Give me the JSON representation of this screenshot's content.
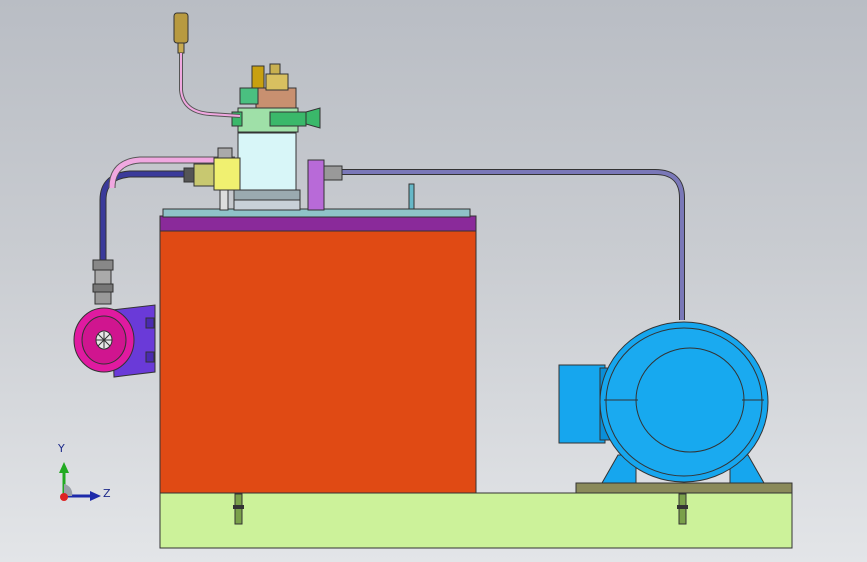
{
  "viewport": {
    "background_top": "#b9bdc4",
    "background_bottom": "#e3e5e8"
  },
  "model": {
    "tank_color": "#e04a14",
    "tank_lid_color": "#8a2a9a",
    "tank_top_plate_color": "#8fc3c8",
    "base_color": "#ccf29a",
    "motor_color": "#16a6ee",
    "motor_ring_color": "#0a8fd8",
    "pump_color": "#e01aa0",
    "pipe_color": "#7a78b8"
  },
  "triad": {
    "y_label": "Y",
    "z_label": "Z",
    "icon": "coordinate-axis-triad-icon"
  }
}
